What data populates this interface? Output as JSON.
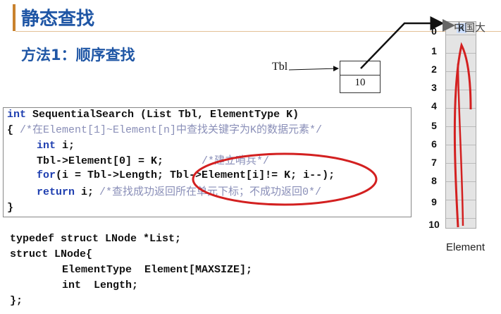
{
  "header": {
    "title": "静态查找",
    "subtitle": "方法1：顺序查找"
  },
  "diagram": {
    "tbl_label": "Tbl",
    "length_value": "10",
    "array_label": "Element",
    "indices": [
      "0",
      "1",
      "2",
      "3",
      "4",
      "5",
      "6",
      "7",
      "8",
      "9",
      "10"
    ],
    "sentinel_value": "K",
    "logo_text": "中国大"
  },
  "code": {
    "line1_kw": "int",
    "line1_rest": " SequentialSearch (List Tbl, ElementType K)",
    "line2_brace": "{ ",
    "line2_comment": "/*在Element[1]~Element[n]中查找关键字为K的数据元素*/",
    "line3_kw": "int",
    "line3_rest": " i;",
    "line4_code": "Tbl->Element[0] = K;",
    "line4_comment": "/*建立哨兵*/",
    "line5_kw": "for",
    "line5_rest": "(i = Tbl->Length; Tbl->Element[i]!= K; i--);",
    "line6_kw": "return",
    "line6_rest": " i;",
    "line6_comment": "/*查找成功返回所在单元下标；不成功返回0*/",
    "line7_brace": "}"
  },
  "struct_code": {
    "line1": "typedef struct LNode *List;",
    "line2": "struct LNode{",
    "line3": "ElementType  Element[MAXSIZE];",
    "line4": "int  Length;",
    "line5": "};"
  },
  "colors": {
    "title_blue": "#1f56a5",
    "keyword_blue": "#1f3fb0",
    "comment_gray": "#8a8fb8",
    "highlight_yellow": "#fff93a",
    "annotation_red": "#d32020",
    "accent_orange": "#c9822e"
  }
}
